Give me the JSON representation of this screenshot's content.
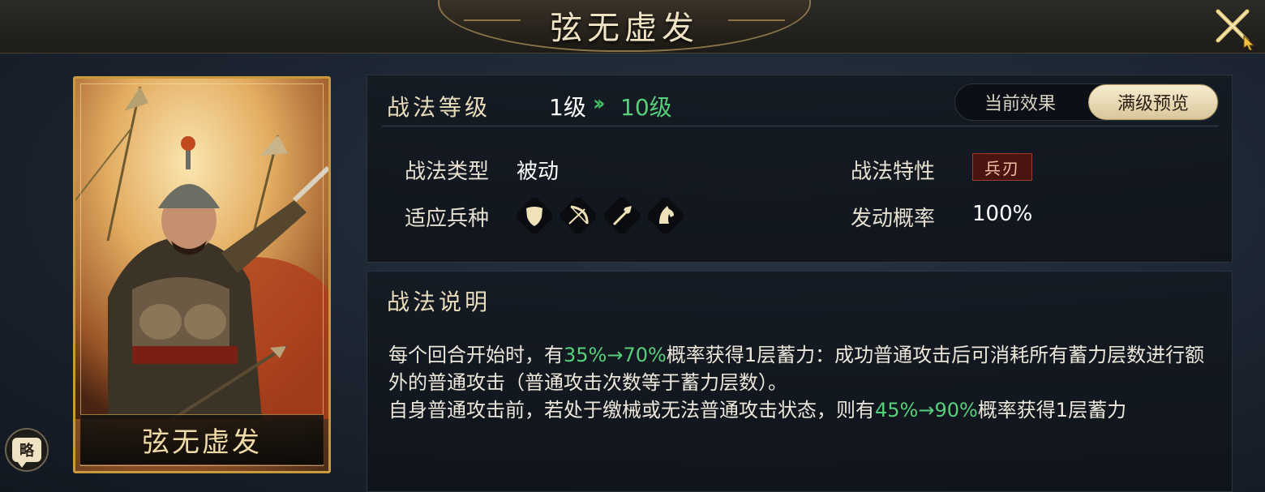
{
  "title": "弦无虚发",
  "card": {
    "name": "弦无虚发"
  },
  "summary_button": {
    "label": "略"
  },
  "level": {
    "label": "战法等级",
    "current": "1级",
    "arrow": "››",
    "max": "10级"
  },
  "toggle": {
    "current_effect": "当前效果",
    "max_preview": "满级预览",
    "selected": "满级预览"
  },
  "attributes": {
    "type_label": "战法类型",
    "type_value": "被动",
    "units_label": "适应兵种",
    "units": [
      "shield-icon",
      "bow-icon",
      "spear-icon",
      "horse-icon"
    ],
    "trait_label": "战法特性",
    "trait_value": "兵刃",
    "chance_label": "发动概率",
    "chance_value": "100%"
  },
  "description": {
    "label": "战法说明",
    "p1_a": "每个回合开始时，有",
    "p1_hl": "35%→70%",
    "p1_b": "概率获得1层蓄力：成功普通攻击后可消耗所有蓄力层数进行额外的普通攻击（普通攻击次数等于蓄力层数）。",
    "p2_a": "自身普通攻击前，若处于缴械或无法普通攻击状态，则有",
    "p2_hl": "45%→90%",
    "p2_b": "概率获得1层蓄力"
  },
  "colors": {
    "highlight": "#56d07a",
    "gold": "#c89a3c",
    "trait_bg": "#4a1510"
  }
}
